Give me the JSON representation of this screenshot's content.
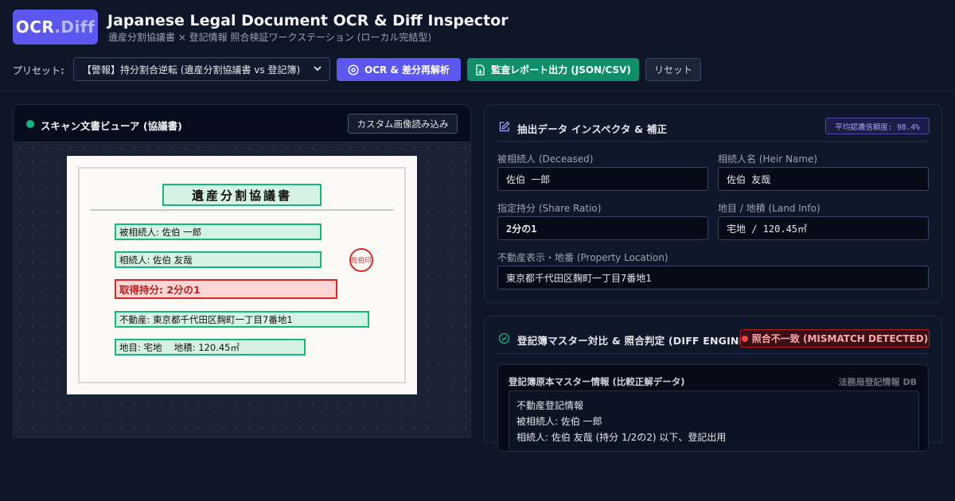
{
  "header": {
    "logo_main": "OCR",
    "logo_suffix": ".Diff",
    "title": "Japanese Legal Document OCR & Diff Inspector",
    "subtitle": "遺産分割協議書 × 登記情報 照合検証ワークステーション (ローカル完結型)"
  },
  "toolbar": {
    "preset_label": "プリセット:",
    "preset_value": "【警報】持分割合逆転 (遺産分割協議書 vs 登記簿)",
    "ocr_button": "OCR & 差分再解析",
    "export_button": "監査レポート出力 (JSON/CSV)",
    "reset_button": "リセット"
  },
  "viewer": {
    "title": "スキャン文書ビューア (協議書)",
    "custom_button": "カスタム画像読み込み",
    "document": {
      "title": "遺産分割協議書",
      "deceased": "被相続人: 佐伯 一郎",
      "heir": "相続人: 佐伯 友哉",
      "seal": "佐伯印",
      "share": "取得持分: 2分の1",
      "property": "不動産: 東京都千代田区麹町一丁目7番地1",
      "land": "地目: 宅地　 地積:  120.45㎡"
    }
  },
  "inspector": {
    "title": "抽出データ インスペクタ & 補正",
    "confidence": "平均認識信頼度: 98.4%",
    "fields": {
      "deceased_label": "被相続人 (Deceased)",
      "deceased_value": "佐伯 一郎",
      "heir_label": "相続人名 (Heir Name)",
      "heir_value": "佐伯 友哉",
      "share_label": "指定持分 (Share Ratio)",
      "share_value": "2分の1",
      "land_label": "地目 / 地積 (Land Info)",
      "land_value": "宅地 / 120.45㎡",
      "location_label": "不動産表示・地番 (Property Location)",
      "location_value": "東京都千代田区麹町一丁目7番地1"
    }
  },
  "diff": {
    "title": "登記簿マスター対比 & 照合判定 (DIFF ENGINE)",
    "status": "照合不一致 (MISMATCH DETECTED)",
    "master_title": "登記簿原本マスター情報 (比較正解データ)",
    "master_source": "法務局登記情報 DB",
    "master_text": "不動産登記情報\n被相続人: 佐伯 一郎\n相続人: 佐伯 友哉 (持分 1/2の2) 以下、登記出用"
  },
  "colors": {
    "accent": "#5b57f0",
    "success": "#0e8f6a",
    "ok_box": "#10b981",
    "error": "#dc2626",
    "background": "#0e1526"
  }
}
